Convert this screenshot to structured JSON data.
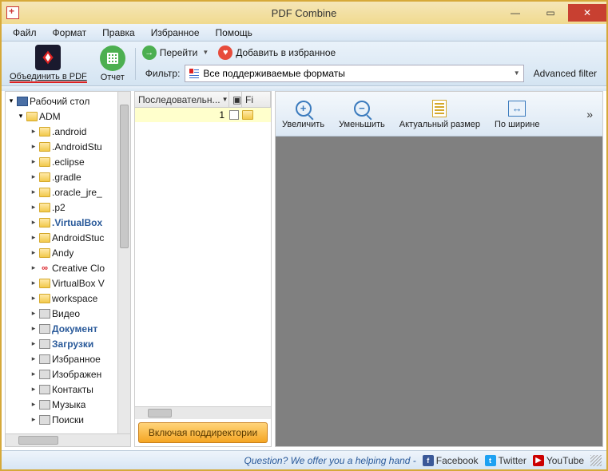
{
  "title": "PDF Combine",
  "menu": [
    "Файл",
    "Формат",
    "Правка",
    "Избранное",
    "Помощь"
  ],
  "toolbar": {
    "combine": "Объединить в PDF",
    "report": "Отчет",
    "go": "Перейти",
    "addFav": "Добавить в избранное",
    "filterLabel": "Фильтр:",
    "filterValue": "Все поддерживаемые форматы",
    "advFilter": "Advanced filter"
  },
  "tree": {
    "root": "Рабочий стол",
    "user": "ADM",
    "items": [
      {
        "name": ".android",
        "type": "folder"
      },
      {
        "name": ".AndroidStu",
        "type": "folder"
      },
      {
        "name": ".eclipse",
        "type": "folder"
      },
      {
        "name": ".gradle",
        "type": "folder"
      },
      {
        "name": ".oracle_jre_",
        "type": "folder"
      },
      {
        "name": ".p2",
        "type": "folder"
      },
      {
        "name": ".VirtualBox",
        "type": "folder",
        "bold": true
      },
      {
        "name": "AndroidStuc",
        "type": "folder"
      },
      {
        "name": "Andy",
        "type": "folder"
      },
      {
        "name": "Creative Clo",
        "type": "cc"
      },
      {
        "name": "VirtualBox V",
        "type": "folder"
      },
      {
        "name": "workspace",
        "type": "folder"
      },
      {
        "name": "Видео",
        "type": "special"
      },
      {
        "name": "Документ",
        "type": "special",
        "bold": true
      },
      {
        "name": "Загрузки",
        "type": "special",
        "bold": true
      },
      {
        "name": "Избранное",
        "type": "special"
      },
      {
        "name": "Изображен",
        "type": "special"
      },
      {
        "name": "Контакты",
        "type": "special"
      },
      {
        "name": "Музыка",
        "type": "special"
      },
      {
        "name": "Поиски",
        "type": "special"
      }
    ]
  },
  "list": {
    "col1": "Последовательн...",
    "col2": "Fi",
    "row1": "1"
  },
  "subdirBtn": "Включая поддиректории",
  "preview": {
    "zoomIn": "Увеличить",
    "zoomOut": "Уменьшить",
    "actual": "Актуальный размер",
    "fitWidth": "По ширине"
  },
  "status": {
    "question": "Question? We offer you a helping hand - ",
    "fb": "Facebook",
    "tw": "Twitter",
    "yt": "YouTube"
  }
}
